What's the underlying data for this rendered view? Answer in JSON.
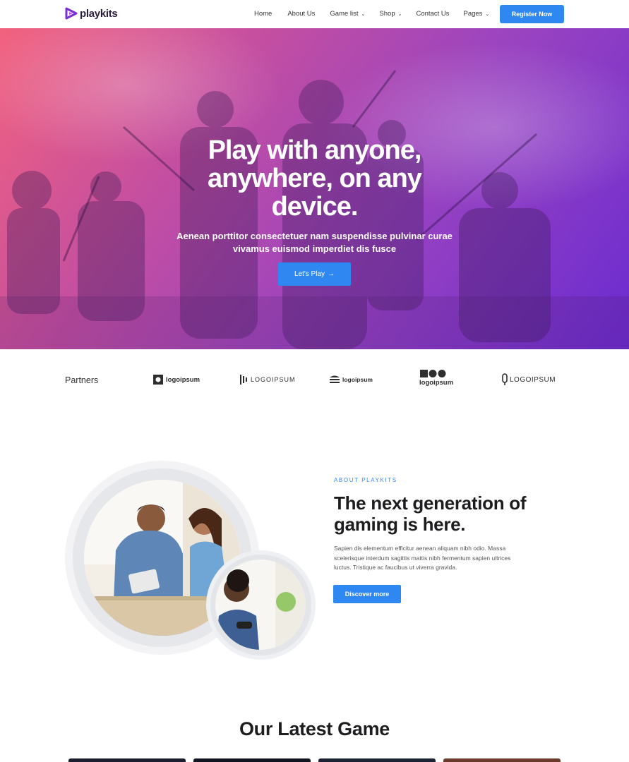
{
  "brand": {
    "name": "playkits"
  },
  "nav": {
    "items": [
      {
        "label": "Home",
        "has_dropdown": false
      },
      {
        "label": "About Us",
        "has_dropdown": false
      },
      {
        "label": "Game list",
        "has_dropdown": true
      },
      {
        "label": "Shop",
        "has_dropdown": true
      },
      {
        "label": "Contact Us",
        "has_dropdown": false
      },
      {
        "label": "Pages",
        "has_dropdown": true
      }
    ],
    "cta": "Register Now",
    "dropdown_icon": "chevron-down-icon"
  },
  "hero": {
    "title": "Play with anyone, anywhere, on any device.",
    "title_lines": [
      "Play with anyone,",
      "anywhere, on any",
      "device."
    ],
    "subtitle_lines": [
      "Aenean porttitor consectetuer nam suspendisse pulvinar curae",
      "vivamus euismod imperdiet dis fusce"
    ],
    "button": "Let's Play",
    "button_icon": "arrow-right-icon"
  },
  "partners": {
    "label": "Partners",
    "logos": [
      {
        "text": "logoipsum",
        "icon": "square-circle-logo-icon"
      },
      {
        "text": "LOGOIPSUM",
        "icon": "stripes-logo-icon"
      },
      {
        "text": "logoipsum",
        "icon": "waves-logo-icon"
      },
      {
        "text": "logoipsum",
        "icon": "blocks-logo-icon"
      },
      {
        "text": "LOGOIPSUM",
        "icon": "bulb-logo-icon"
      }
    ]
  },
  "about": {
    "eyebrow": "ABOUT PLAYKITS",
    "title_lines": [
      "The next generation of",
      "gaming is here."
    ],
    "text_lines": [
      "Sapien dis elementum efficitur aenean aliquam nibh odio. Massa",
      "scelerisque interdum sagittis mattis nibh fermentum sapien ultrices",
      "luctus. Tristique ac faucibus ut viverra gravida."
    ],
    "button": "Discover more"
  },
  "latest": {
    "title": "Our Latest Game"
  },
  "colors": {
    "accent": "#2f88f2",
    "brand_purple": "#7b2fd6",
    "hero_gradient_start": "#f2627e",
    "hero_gradient_end": "#6b2bd0"
  }
}
